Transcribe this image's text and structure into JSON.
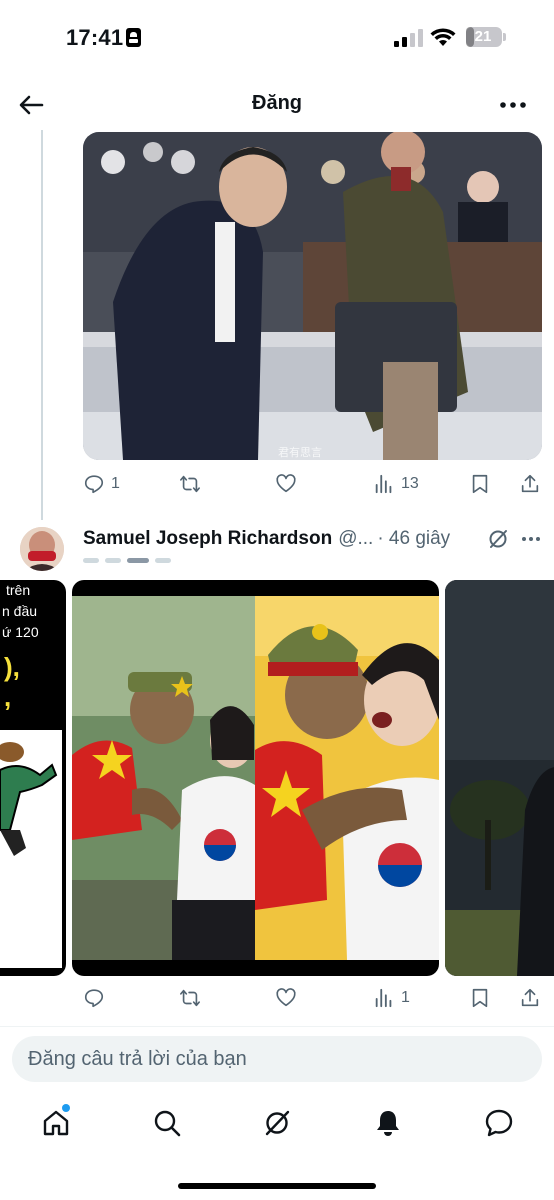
{
  "status_bar": {
    "time": "17:41",
    "battery": "21",
    "battery_level": 0.21
  },
  "header": {
    "title": "Đăng"
  },
  "post1": {
    "photo_caption": "君有思言",
    "actions": {
      "replies": "1",
      "views": "13"
    }
  },
  "post2": {
    "author_name": "Samuel Joseph Richardson",
    "handle": "@...",
    "time": "· 46 giây",
    "carousel_page_count": 4,
    "carousel_active_index": 2,
    "card1_text": {
      "line1": "trên",
      "line2": "n đầu",
      "line3": "ứ 120",
      "big": "),",
      "big2": ","
    },
    "actions": {
      "views": "1"
    }
  },
  "reply": {
    "placeholder": "Đăng câu trả lời của bạn"
  },
  "colors": {
    "accent": "#1d9bf0",
    "icon_gray": "#536471",
    "text": "#0f1419"
  }
}
